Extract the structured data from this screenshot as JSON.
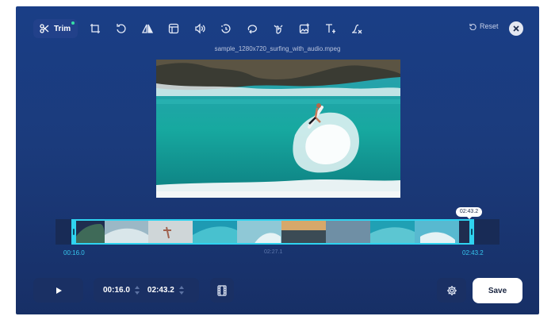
{
  "toolbar": {
    "trim_label": "Trim",
    "icons": [
      "scissors-icon",
      "crop-icon",
      "rotate-icon",
      "flip-icon",
      "subtitle-icon",
      "volume-icon",
      "speed-icon",
      "loop-icon",
      "stabilize-icon",
      "image-overlay-icon",
      "text-icon",
      "remove-watermark-icon"
    ]
  },
  "header": {
    "reset_label": "Reset",
    "file_name": "sample_1280x720_surfing_with_audio.mpeg"
  },
  "timeline": {
    "start_time": "00:16.0",
    "end_time": "02:43.2",
    "mid_time": "02:27.1",
    "tooltip": "02:43.2",
    "selection_start_fraction": 0.1,
    "selection_end_fraction": 0.97
  },
  "controls": {
    "start_value": "00:16.0",
    "end_value": "02:43.2",
    "save_label": "Save"
  },
  "colors": {
    "background": "#1b3b7c",
    "accent": "#2fd3f0",
    "badge": "#36e0a6"
  }
}
